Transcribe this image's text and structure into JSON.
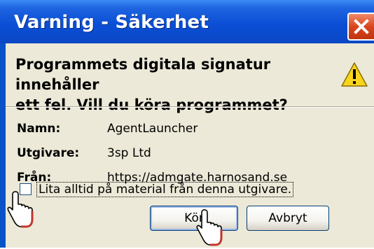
{
  "window": {
    "title": "Varning - Säkerhet"
  },
  "message": {
    "line1": "Programmets digitala signatur innehåller",
    "line2": "ett fel. Vill du köra programmet?"
  },
  "fields": {
    "name_label": "Namn:",
    "name_value": "AgentLauncher",
    "publisher_label": "Utgivare:",
    "publisher_value": "3sp Ltd",
    "from_label": "Från:",
    "from_value": "https://admgate.harnosand.se"
  },
  "trust_checkbox": {
    "label": "Lita alltid på material från denna utgivare.",
    "checked": false
  },
  "buttons": {
    "run_label": "Kör",
    "cancel_label": "Avbryt"
  },
  "icons": {
    "warning": "warning-triangle-icon",
    "close": "close-icon",
    "pointer": "hand-pointer-icon"
  },
  "colors": {
    "titlebar": "#0b4fd6",
    "client_bg": "#ece9d8",
    "close_button": "#d9461f",
    "warning_yellow": "#f7d51d"
  }
}
